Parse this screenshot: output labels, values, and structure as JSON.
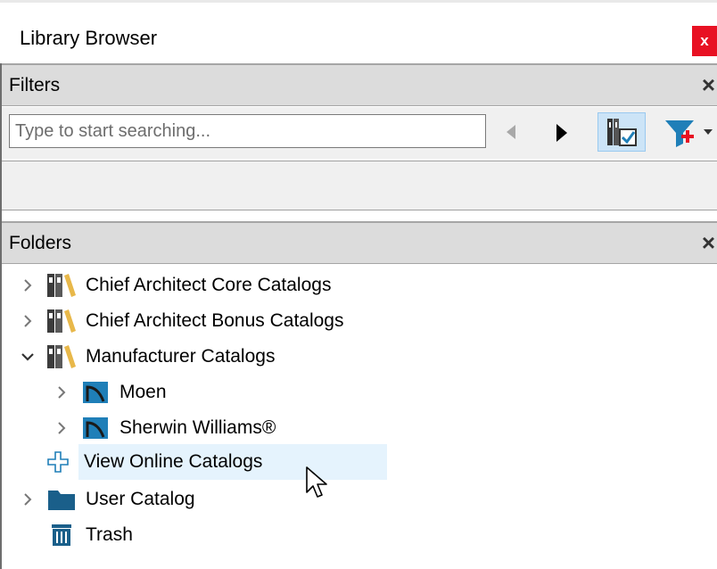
{
  "window": {
    "title": "Library Browser",
    "close_label": "x"
  },
  "filters": {
    "header": "Filters",
    "close_label": "×",
    "search_placeholder": "Type to start searching..."
  },
  "folders": {
    "header": "Folders",
    "close_label": "×",
    "items": [
      {
        "label": "Chief Architect Core Catalogs",
        "icon": "library-books-icon",
        "expander": "collapsed"
      },
      {
        "label": "Chief Architect Bonus Catalogs",
        "icon": "library-books-icon",
        "expander": "collapsed"
      },
      {
        "label": "Manufacturer Catalogs",
        "icon": "library-books-icon",
        "expander": "expanded"
      },
      {
        "label": "Moen",
        "icon": "manufacturer-catalog-icon",
        "expander": "collapsed"
      },
      {
        "label": "Sherwin Williams®",
        "icon": "manufacturer-catalog-icon",
        "expander": "collapsed"
      },
      {
        "label": "View Online Catalogs",
        "icon": "plus-icon",
        "expander": "none",
        "hovered": true
      },
      {
        "label": "User Catalog",
        "icon": "folder-icon",
        "expander": "collapsed"
      },
      {
        "label": "Trash",
        "icon": "trash-icon",
        "expander": "none"
      }
    ]
  },
  "colors": {
    "close_red": "#e81123",
    "accent_blue": "#1f7fb8",
    "hover_bg": "#e5f3fd",
    "toggle_bg": "#cce4f7"
  }
}
